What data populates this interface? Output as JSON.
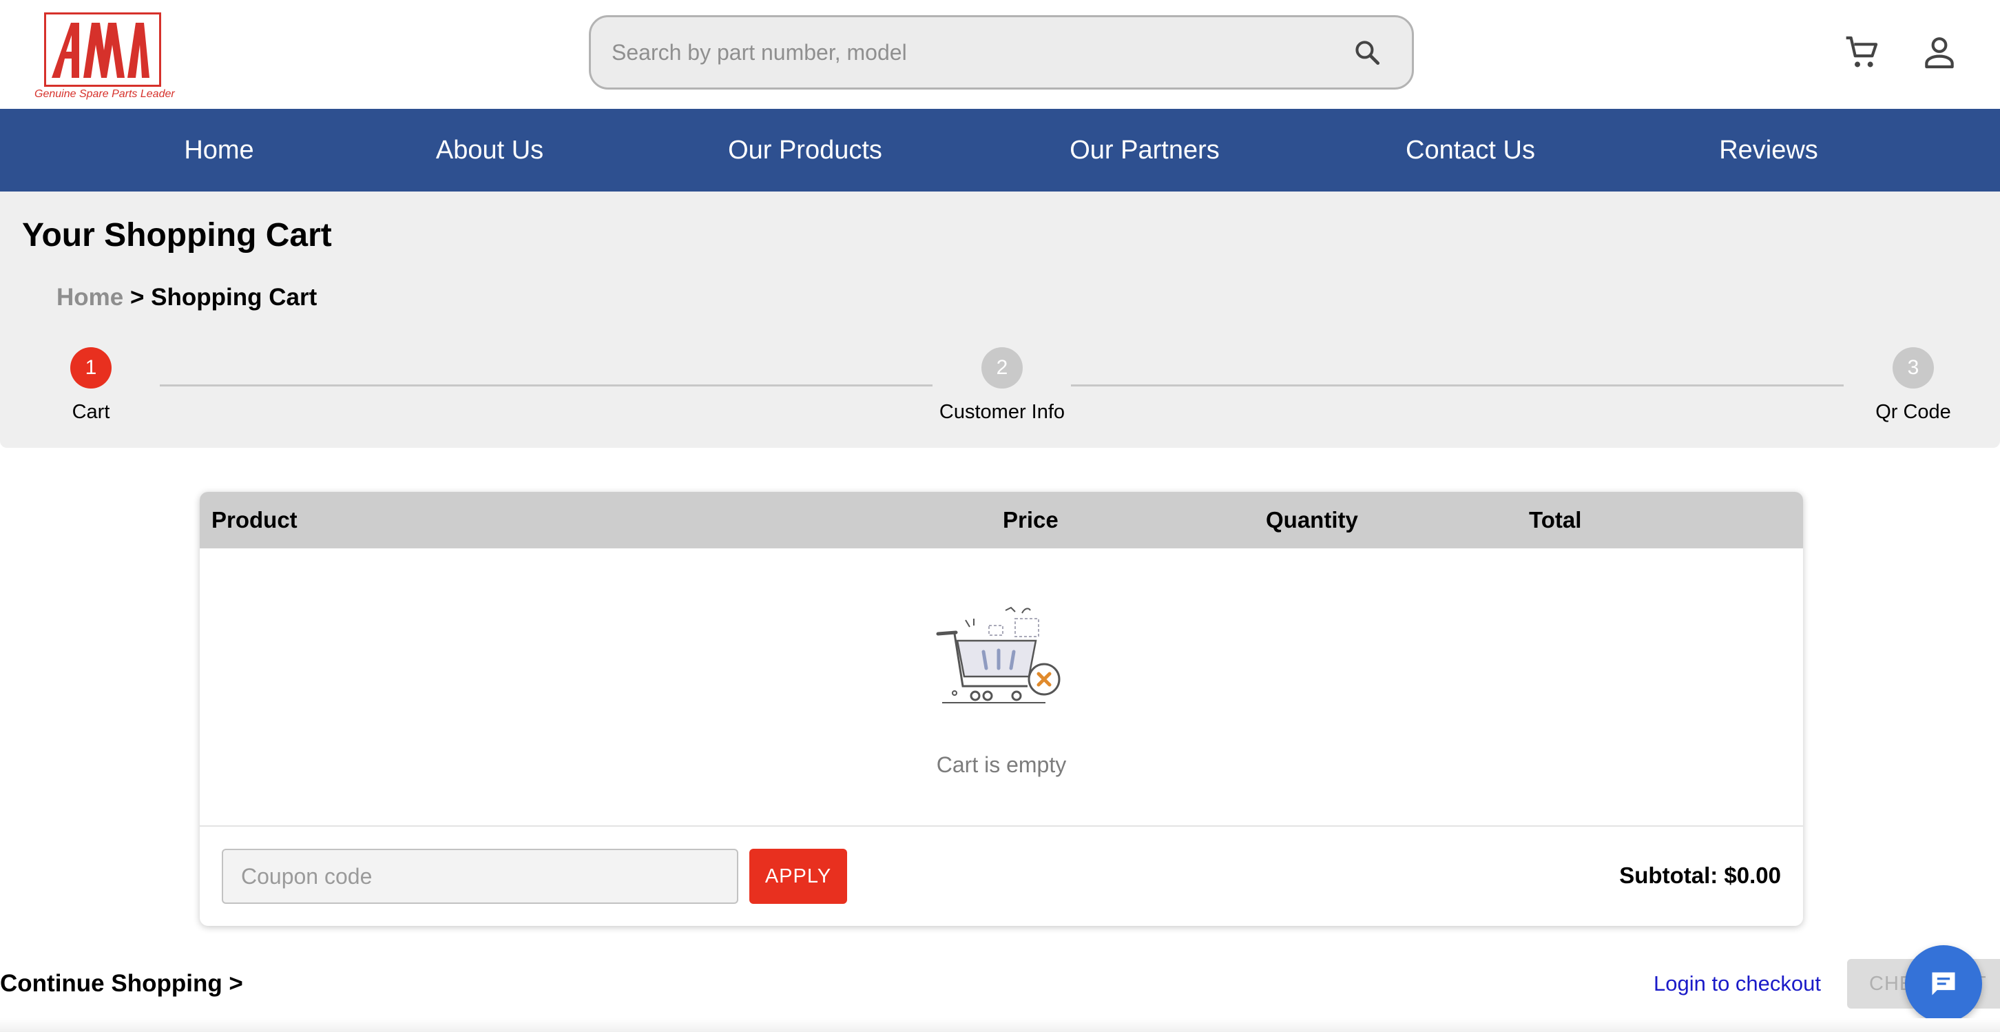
{
  "brand": {
    "logo_letters": "AM",
    "tagline": "Genuine Spare Parts Leader",
    "primary_color": "#2e5090",
    "accent_color": "#e8301f"
  },
  "search": {
    "placeholder": "Search by part number, model",
    "icon": "search-icon"
  },
  "header_icons": [
    "cart-icon",
    "user-icon"
  ],
  "nav": {
    "items": [
      {
        "label": "Home"
      },
      {
        "label": "About Us"
      },
      {
        "label": "Our Products"
      },
      {
        "label": "Our Partners"
      },
      {
        "label": "Contact Us"
      },
      {
        "label": "Reviews"
      }
    ]
  },
  "page": {
    "title": "Your Shopping Cart",
    "breadcrumb": {
      "home": "Home",
      "separator": " > ",
      "current": "Shopping Cart"
    }
  },
  "steps": [
    {
      "number": "1",
      "label": "Cart",
      "active": true
    },
    {
      "number": "2",
      "label": "Customer Info",
      "active": false
    },
    {
      "number": "3",
      "label": "Qr Code",
      "active": false
    }
  ],
  "cart": {
    "columns": [
      "Product",
      "Price",
      "Quantity",
      "Total"
    ],
    "empty_message": "Cart is empty",
    "coupon_placeholder": "Coupon code",
    "apply_label": "APPLY",
    "subtotal_label": "Subtotal: $0.00"
  },
  "footer_actions": {
    "continue_label": "Continue Shopping >",
    "login_label": "Login to checkout",
    "checkout_label": "CHECKOUT"
  }
}
